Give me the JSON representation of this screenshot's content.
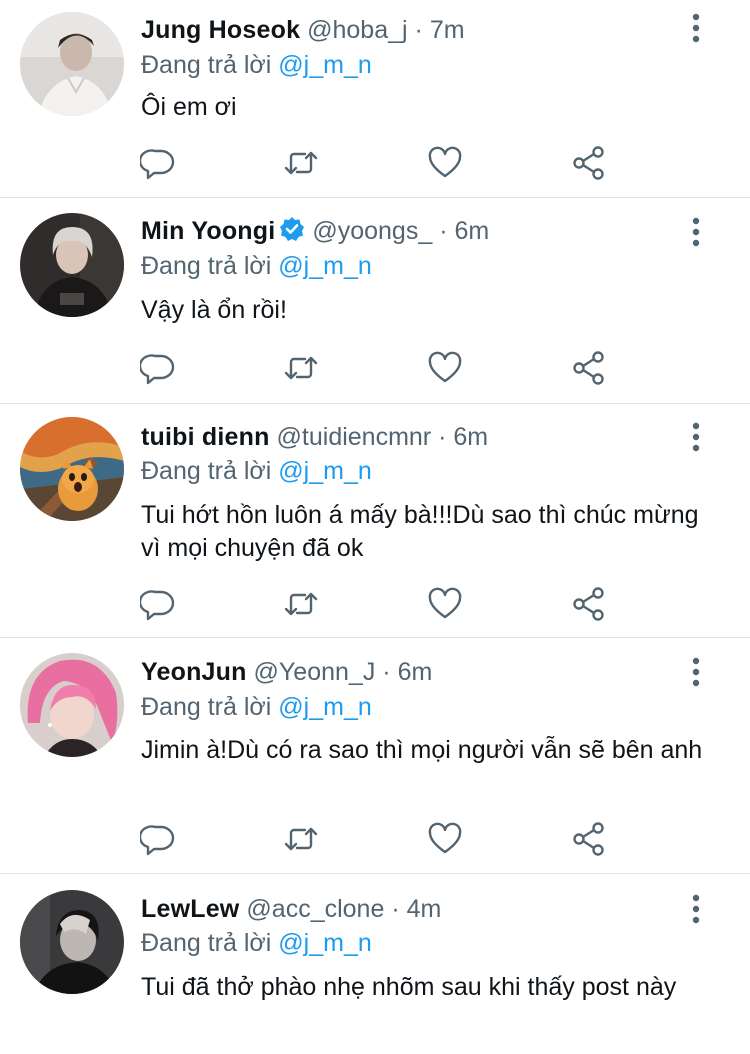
{
  "replying_label": "Đang trả lời",
  "tweets": [
    {
      "name": "Jung Hoseok",
      "handle": "@hoba_j",
      "dot": "·",
      "time": "7m",
      "verified": false,
      "replying_to": "@j_m_n",
      "text": "Ôi em ơi",
      "avatar": "avatar-hoseok"
    },
    {
      "name": "Min Yoongi",
      "handle": "@yoongs_",
      "dot": "·",
      "time": "6m",
      "verified": true,
      "replying_to": "@j_m_n",
      "text": "Vậy là ổn rồi!",
      "avatar": "avatar-yoongi"
    },
    {
      "name": "tuibi dienn",
      "handle": "@tuidiencmnr",
      "dot": "·",
      "time": "6m",
      "verified": false,
      "replying_to": "@j_m_n",
      "text": "Tui hớt hồn luôn á mấy bà!!!Dù sao thì chúc mừng vì mọi chuyện đã ok",
      "avatar": "avatar-scream-cat"
    },
    {
      "name": "YeonJun",
      "handle": "@Yeonn_J",
      "dot": "·",
      "time": "6m",
      "verified": false,
      "replying_to": "@j_m_n",
      "text": "Jimin à!Dù có ra sao thì mọi người vẫn sẽ bên anh",
      "avatar": "avatar-yeonjun"
    },
    {
      "name": "LewLew",
      "handle": "@acc_clone",
      "dot": "·",
      "time": "4m",
      "verified": false,
      "replying_to": "@j_m_n",
      "text": "Tui đã thở phào nhẹ nhõm sau khi thấy post này",
      "avatar": "avatar-lewlew"
    }
  ],
  "icons": {
    "reply": "reply-icon",
    "retweet": "retweet-icon",
    "like": "like-icon",
    "share": "share-icon",
    "more": "more-icon",
    "verified": "verified-badge-icon"
  },
  "colors": {
    "text": "#0f1419",
    "secondary": "#536471",
    "mention": "#1d9bf0",
    "verified": "#1d9bf0",
    "divider": "#dfe3e6"
  }
}
